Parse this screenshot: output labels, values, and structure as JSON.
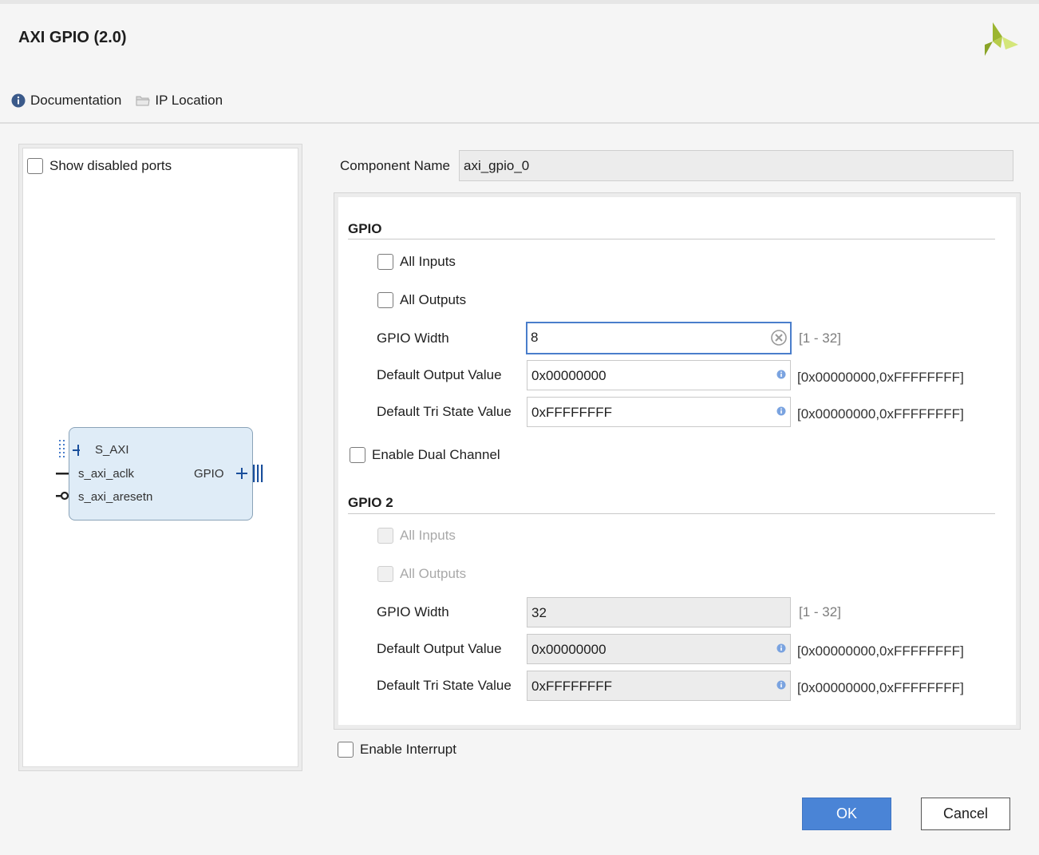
{
  "window": {
    "title": "AXI GPIO (2.0)"
  },
  "toolbar": {
    "documentation": "Documentation",
    "ip_location": "IP Location"
  },
  "left_panel": {
    "show_disabled_ports": "Show disabled ports",
    "ip_symbol": {
      "ports_left": [
        "S_AXI",
        "s_axi_aclk",
        "s_axi_aresetn"
      ],
      "ports_right": [
        "GPIO"
      ]
    }
  },
  "component": {
    "label": "Component Name",
    "value": "axi_gpio_0"
  },
  "gpio": {
    "section_title": "GPIO",
    "all_inputs": "All Inputs",
    "all_outputs": "All Outputs",
    "width_label": "GPIO Width",
    "width_value": "8",
    "width_range": "[1 - 32]",
    "dout_label": "Default Output Value",
    "dout_value": "0x00000000",
    "dout_range": "[0x00000000,0xFFFFFFFF]",
    "tri_label": "Default Tri State Value",
    "tri_value": "0xFFFFFFFF",
    "tri_range": "[0x00000000,0xFFFFFFFF]"
  },
  "dual_channel": {
    "label": "Enable Dual Channel"
  },
  "gpio2": {
    "section_title": "GPIO 2",
    "all_inputs": "All Inputs",
    "all_outputs": "All Outputs",
    "width_label": "GPIO Width",
    "width_value": "32",
    "width_range": "[1 - 32]",
    "dout_label": "Default Output Value",
    "dout_value": "0x00000000",
    "dout_range": "[0x00000000,0xFFFFFFFF]",
    "tri_label": "Default Tri State Value",
    "tri_value": "0xFFFFFFFF",
    "tri_range": "[0x00000000,0xFFFFFFFF]"
  },
  "interrupt": {
    "label": "Enable Interrupt"
  },
  "buttons": {
    "ok": "OK",
    "cancel": "Cancel"
  },
  "colors": {
    "accent": "#4a84d6",
    "focus_border": "#4a7ecb",
    "logo_green": "#9bb52f",
    "ip_block_fill": "#dfecf7"
  }
}
